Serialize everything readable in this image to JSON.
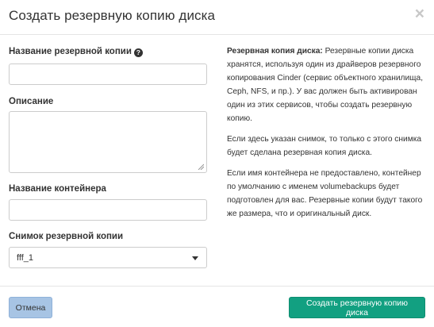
{
  "dialog": {
    "title": "Создать резервную копию диска",
    "close_glyph": "×"
  },
  "form": {
    "name_label": "Название резервной копии",
    "name_value": "",
    "description_label": "Описание",
    "description_value": "",
    "container_label": "Название контейнера",
    "container_value": "",
    "snapshot_label": "Снимок резервной копии",
    "snapshot_selected": "fff_1"
  },
  "help": {
    "p1_bold": "Резервная копия диска:",
    "p1_text": " Резервные копии диска хранятся, используя один из драйверов резервного копирования Cinder (сервис объектного хранилища, Ceph, NFS, и пр.). У вас должен быть активирован один из этих сервисов, чтобы создать резервную копию.",
    "p2": "Если здесь указан снимок, то только с этого снимка будет сделана резервная копия диска.",
    "p3": "Если имя контейнера не предоставлено, контейнер по умолчанию с именем volumebackups будет подготовлен для вас. Резервные копии будут такого же размера, что и оригинальный диск."
  },
  "footer": {
    "cancel_label": "Отмена",
    "submit_label": "Создать резервную копию диска"
  },
  "colors": {
    "primary": "#12a081",
    "cancel": "#a7c4e4"
  },
  "icons": {
    "help": "question-circle-icon",
    "close": "close-icon",
    "caret": "caret-down-icon"
  }
}
